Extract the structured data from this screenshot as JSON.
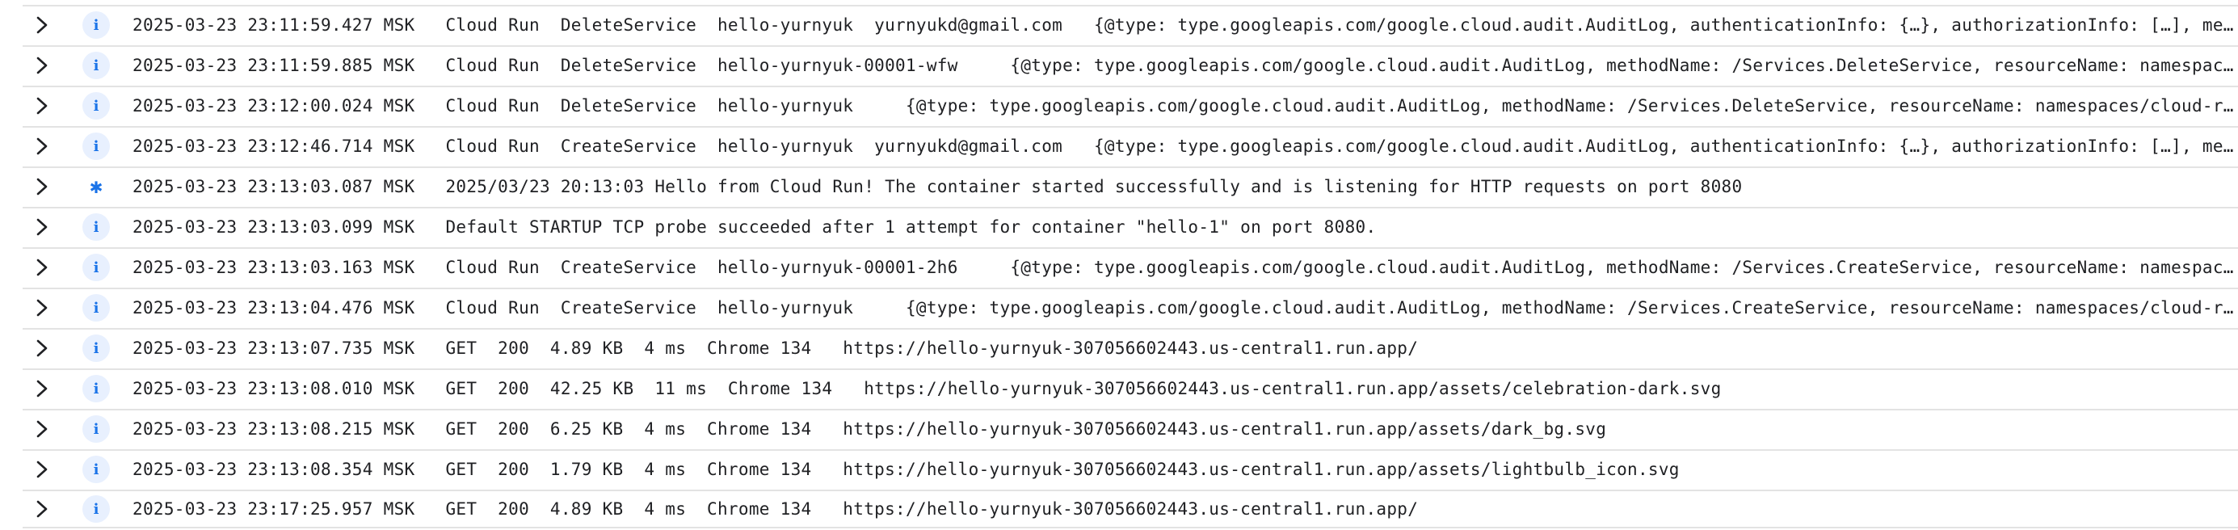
{
  "log_entries": [
    {
      "severity": "info",
      "severity_glyph": "i",
      "timestamp": "2025-03-23 23:11:59.427 MSK",
      "summary": "Cloud Run  DeleteService  hello-yurnyuk  yurnyukd@gmail.com   {@type: type.googleapis.com/google.cloud.audit.AuditLog, authenticationInfo: {…}, authorizationInfo: […], methodName: /Services.DeleteService, resourceName: namespaces/cloud"
    },
    {
      "severity": "info",
      "severity_glyph": "i",
      "timestamp": "2025-03-23 23:11:59.885 MSK",
      "summary": "Cloud Run  DeleteService  hello-yurnyuk-00001-wfw     {@type: type.googleapis.com/google.cloud.audit.AuditLog, methodName: /Services.DeleteService, resourceName: namespaces/cloud-run"
    },
    {
      "severity": "info",
      "severity_glyph": "i",
      "timestamp": "2025-03-23 23:12:00.024 MSK",
      "summary": "Cloud Run  DeleteService  hello-yurnyuk     {@type: type.googleapis.com/google.cloud.audit.AuditLog, methodName: /Services.DeleteService, resourceName: namespaces/cloud-run"
    },
    {
      "severity": "info",
      "severity_glyph": "i",
      "timestamp": "2025-03-23 23:12:46.714 MSK",
      "summary": "Cloud Run  CreateService  hello-yurnyuk  yurnyukd@gmail.com   {@type: type.googleapis.com/google.cloud.audit.AuditLog, authenticationInfo: {…}, authorizationInfo: […], methodName: /Services.CreateService, resourceName: namespaces/cloud"
    },
    {
      "severity": "default",
      "severity_glyph": "✱",
      "timestamp": "2025-03-23 23:13:03.087 MSK",
      "summary": "2025/03/23 20:13:03 Hello from Cloud Run! The container started successfully and is listening for HTTP requests on port 8080"
    },
    {
      "severity": "info",
      "severity_glyph": "i",
      "timestamp": "2025-03-23 23:13:03.099 MSK",
      "summary": "Default STARTUP TCP probe succeeded after 1 attempt for container \"hello-1\" on port 8080."
    },
    {
      "severity": "info",
      "severity_glyph": "i",
      "timestamp": "2025-03-23 23:13:03.163 MSK",
      "summary": "Cloud Run  CreateService  hello-yurnyuk-00001-2h6     {@type: type.googleapis.com/google.cloud.audit.AuditLog, methodName: /Services.CreateService, resourceName: namespaces/cloud-run"
    },
    {
      "severity": "info",
      "severity_glyph": "i",
      "timestamp": "2025-03-23 23:13:04.476 MSK",
      "summary": "Cloud Run  CreateService  hello-yurnyuk     {@type: type.googleapis.com/google.cloud.audit.AuditLog, methodName: /Services.CreateService, resourceName: namespaces/cloud-run"
    },
    {
      "severity": "info",
      "severity_glyph": "i",
      "timestamp": "2025-03-23 23:13:07.735 MSK",
      "summary": "GET  200  4.89 KB  4 ms  Chrome 134   https://hello-yurnyuk-307056602443.us-central1.run.app/"
    },
    {
      "severity": "info",
      "severity_glyph": "i",
      "timestamp": "2025-03-23 23:13:08.010 MSK",
      "summary": "GET  200  42.25 KB  11 ms  Chrome 134   https://hello-yurnyuk-307056602443.us-central1.run.app/assets/celebration-dark.svg"
    },
    {
      "severity": "info",
      "severity_glyph": "i",
      "timestamp": "2025-03-23 23:13:08.215 MSK",
      "summary": "GET  200  6.25 KB  4 ms  Chrome 134   https://hello-yurnyuk-307056602443.us-central1.run.app/assets/dark_bg.svg"
    },
    {
      "severity": "info",
      "severity_glyph": "i",
      "timestamp": "2025-03-23 23:13:08.354 MSK",
      "summary": "GET  200  1.79 KB  4 ms  Chrome 134   https://hello-yurnyuk-307056602443.us-central1.run.app/assets/lightbulb_icon.svg"
    },
    {
      "severity": "info",
      "severity_glyph": "i",
      "timestamp": "2025-03-23 23:17:25.957 MSK",
      "summary": "GET  200  4.89 KB  4 ms  Chrome 134   https://hello-yurnyuk-307056602443.us-central1.run.app/"
    }
  ],
  "colors": {
    "info_icon": "#1a73e8",
    "info_icon_bg": "#e8f0fe",
    "row_border": "#e3e3e3",
    "text": "#202124"
  },
  "icons": {
    "expand": "chevron-right-icon",
    "info": "info-icon",
    "default": "asterisk-icon"
  }
}
